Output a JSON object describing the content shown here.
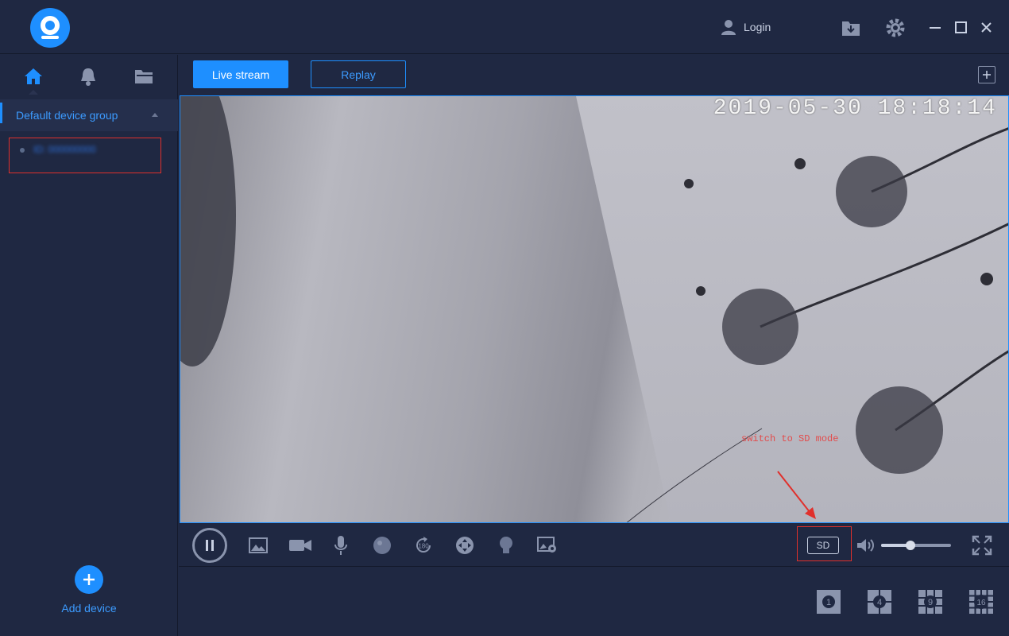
{
  "header": {
    "login_label": "Login",
    "icons": [
      "logo-icon",
      "user-icon",
      "download-icon",
      "settings-icon",
      "minimize-icon",
      "maximize-icon",
      "close-icon"
    ]
  },
  "sidebar": {
    "tabs": [
      "home-icon",
      "bell-icon",
      "folder-icon"
    ],
    "group_label": "Default device group",
    "device_label": "ID: 000000000",
    "add_device_label": "Add device"
  },
  "main": {
    "live_label": "Live stream",
    "replay_label": "Replay",
    "timestamp": "2019-05-30  18:18:14",
    "annotation": "switch to SD mode",
    "quality_label": "SD",
    "volume": 0.42,
    "layouts": [
      "1",
      "4",
      "9",
      "16"
    ]
  },
  "colors": {
    "accent": "#1e8fff",
    "background": "#1f2842",
    "annotation": "#e0302c"
  }
}
